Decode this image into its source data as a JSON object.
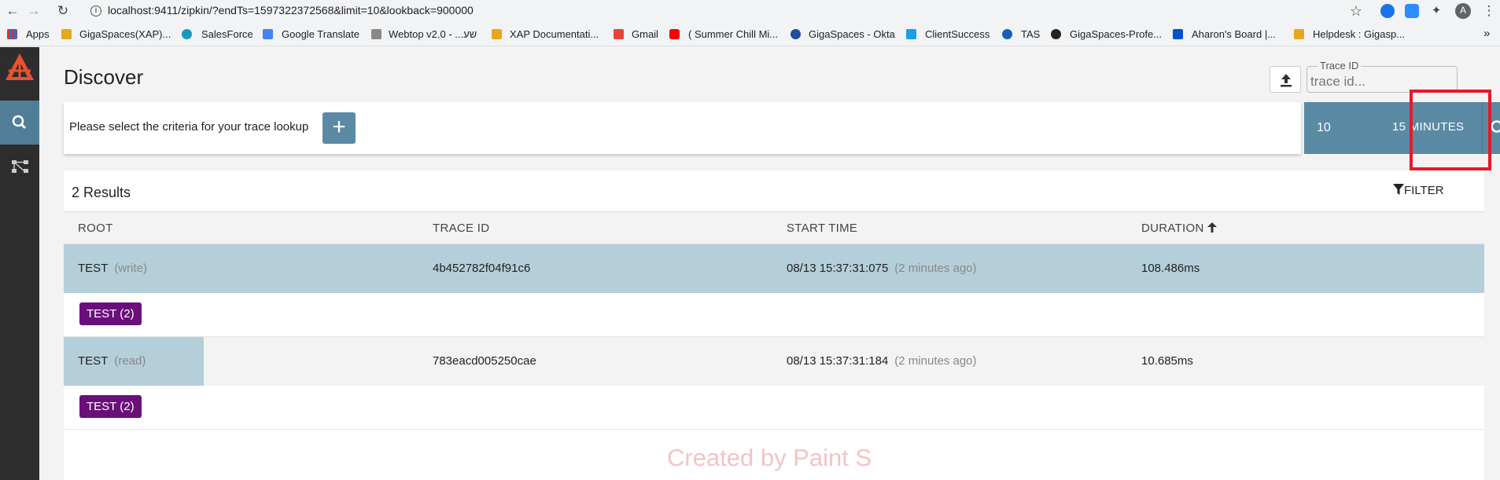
{
  "browser": {
    "url": "localhost:9411/zipkin/?endTs=1597322372568&limit=10&lookback=900000",
    "profile_initial": "A",
    "bookmarks": [
      "Apps",
      "GigaSpaces(XAP)...",
      "SalesForce",
      "Google Translate",
      "Webtop v2.0 - ...שע",
      "XAP Documentati...",
      "Gmail",
      "( Summer Chill Mi...",
      "GigaSpaces - Okta",
      "ClientSuccess",
      "TAS",
      "GigaSpaces-Profe...",
      "Aharon's Board |...",
      "Helpdesk : Gigasp..."
    ],
    "overflow_label": "»"
  },
  "colors": {
    "accent": "#5a8aa4",
    "highlight": "#e41a2a",
    "badge": "#6a0f7a",
    "selected_row": "#b5cfda",
    "sidebar": "#2d2d2d"
  },
  "icons": [
    "back-icon",
    "forward-icon",
    "reload-icon",
    "info-icon",
    "star-icon",
    "extensions-icon",
    "menu-icon",
    "zipkin-logo",
    "search-icon",
    "dependencies-icon",
    "upload-icon",
    "plus-icon",
    "filter-icon",
    "sort-up-arrow-icon"
  ],
  "page": {
    "title": "Discover",
    "trace_id_label": "Trace ID",
    "trace_id_placeholder": "trace id...",
    "criteria_prompt": "Please select the criteria for your trace lookup",
    "plus_label": "+",
    "limit": "10",
    "lookback": "15 MINUTES"
  },
  "results": {
    "count_label": "2 Results",
    "filter_label": "FILTER",
    "columns": {
      "root": "ROOT",
      "trace_id": "TRACE ID",
      "start_time": "START TIME",
      "duration": "DURATION"
    },
    "rows": [
      {
        "root": "TEST",
        "root_span": "(write)",
        "trace_id": "4b452782f04f91c6",
        "start_time": "08/13 15:37:31:075",
        "start_ago": "(2 minutes ago)",
        "duration": "108.486ms",
        "service_badge": "TEST (2)",
        "duration_fraction": 1.0
      },
      {
        "root": "TEST",
        "root_span": "(read)",
        "trace_id": "783eacd005250cae",
        "start_time": "08/13 15:37:31:184",
        "start_ago": "(2 minutes ago)",
        "duration": "10.685ms",
        "service_badge": "TEST (2)",
        "duration_fraction": 0.0985
      }
    ]
  },
  "watermark": "Created by Paint S"
}
